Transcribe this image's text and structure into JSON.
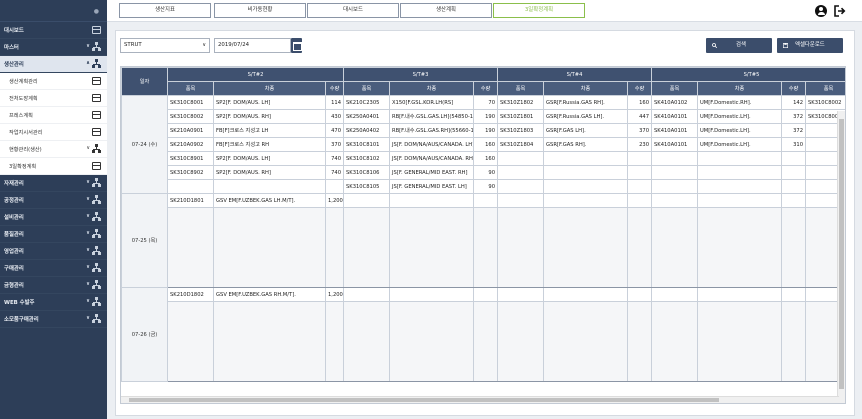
{
  "sidebar": {
    "items": [
      {
        "label": "대시보드",
        "type": "top",
        "icon": "window-icon"
      },
      {
        "label": "마스터",
        "type": "top",
        "icon": "tree-icon",
        "chevron": "∨"
      },
      {
        "label": "생산관리",
        "type": "open",
        "icon": "tree-icon",
        "chevron": "∧"
      },
      {
        "label": "생산계획관리",
        "type": "sub",
        "icon": "window-icon"
      },
      {
        "label": "전처도장계획",
        "type": "sub",
        "icon": "window-icon"
      },
      {
        "label": "프레스계획",
        "type": "sub",
        "icon": "window-icon"
      },
      {
        "label": "작업지시서관리",
        "type": "sub",
        "icon": "window-icon"
      },
      {
        "label": "현황관리(생산)",
        "type": "sub",
        "icon": "tree-icon",
        "chevron": "∨"
      },
      {
        "label": "3일확정계획",
        "type": "sub",
        "icon": "window-icon"
      },
      {
        "label": "자재관리",
        "type": "top",
        "icon": "tree-icon",
        "chevron": "∨"
      },
      {
        "label": "공정관리",
        "type": "top",
        "icon": "tree-icon",
        "chevron": "∨"
      },
      {
        "label": "설비관리",
        "type": "top",
        "icon": "tree-icon",
        "chevron": "∨"
      },
      {
        "label": "품질관리",
        "type": "top",
        "icon": "tree-icon",
        "chevron": "∨"
      },
      {
        "label": "영업관리",
        "type": "top",
        "icon": "tree-icon",
        "chevron": "∨"
      },
      {
        "label": "구매관리",
        "type": "top",
        "icon": "tree-icon",
        "chevron": "∨"
      },
      {
        "label": "금형관리",
        "type": "top",
        "icon": "tree-icon",
        "chevron": "∨"
      },
      {
        "label": "WEB 수발주",
        "type": "top",
        "icon": "tree-icon",
        "chevron": "∨"
      },
      {
        "label": "소모품구매관리",
        "type": "top",
        "icon": "tree-icon",
        "chevron": "∨"
      }
    ]
  },
  "tabs": [
    {
      "label": "생산지표",
      "active": false
    },
    {
      "label": "비가동현황",
      "active": false
    },
    {
      "label": "대시보드",
      "active": false
    },
    {
      "label": "생산계획",
      "active": false
    },
    {
      "label": "3일확정계획",
      "active": true
    }
  ],
  "toolbar": {
    "select_value": "STRUT",
    "select_arrow": "∨",
    "date_value": "2019/07/24",
    "search_label": "검색",
    "excel_label": "엑셀다운로드"
  },
  "grid": {
    "date_header": "일자",
    "groups": [
      "S/T#2",
      "S/T#3",
      "S/T#4",
      "S/T#5"
    ],
    "col_item": "품목",
    "col_car": "차종",
    "col_qty": "수량",
    "days": [
      {
        "label": "07-24 (수)",
        "rows": [
          [
            "SK310C8001",
            "SP2[F. DOM/AUS. LH]",
            "114",
            "SK210C2305",
            "X150[F.GSL.KOR.LH(RS]",
            "70",
            "SK310Z1802",
            "GSR[F.Russia.GAS RH].",
            "160",
            "SK410A0102",
            "UM[F.Domestic.RH].",
            "142",
            "SK310C8002"
          ],
          [
            "SK310C8002",
            "SP2[F. DOM/AUS. RH]",
            "430",
            "SK250A0401",
            "RB[F.내수.GSL.GAS.LH](54850-1R",
            "190",
            "SK310Z1801",
            "GSR[F.Russia.GAS LH].",
            "447",
            "SK410A0101",
            "UM[F.Domestic.LH].",
            "372",
            "SK310C8001"
          ],
          [
            "SK210A0901",
            "FB[F]크로스 지성고 LH",
            "470",
            "SK250A0402",
            "RB[F.내수.GSL.GAS.RH](55660-1R",
            "190",
            "SK310Z1803",
            "GSR[F.GAS LH].",
            "370",
            "SK410A0101",
            "UM[F.Domestic.LH].",
            "372",
            ""
          ],
          [
            "SK210A0902",
            "FB[F]크로스 지성고 RH",
            "370",
            "SK310C8101",
            "JS[F. DOM/NA/AUS/CANADA. LH]",
            "160",
            "SK310Z1804",
            "GSR[F.GAS RH].",
            "230",
            "SK410A0101",
            "UM[F.Domestic.LH].",
            "310",
            ""
          ],
          [
            "SK310C8901",
            "SP2[F. DOM/AUS. LH]",
            "740",
            "SK310C8102",
            "JS[F. DOM/NA/AUS/CANADA. RH]",
            "160",
            "",
            "",
            "",
            "",
            "",
            "",
            ""
          ],
          [
            "SK310C8902",
            "SP2[F. DOM/AUS. RH]",
            "740",
            "SK310C8106",
            "JS[F. GENERAL/MID EAST. RH]",
            "90",
            "",
            "",
            "",
            "",
            "",
            "",
            ""
          ],
          [
            "",
            "",
            "",
            "SK310C8105",
            "JS[F. GENERAL/MID EAST. LH]",
            "90",
            "",
            "",
            "",
            "",
            "",
            "",
            ""
          ]
        ]
      },
      {
        "label": "07-25 (목)",
        "rows": [
          [
            "SK210D1801",
            "GSV EM[F.UZBEK.GAS LH.M/T].",
            "1,200",
            "",
            "",
            "",
            "",
            "",
            "",
            "",
            "",
            "",
            ""
          ]
        ]
      },
      {
        "label": "07-26 (금)",
        "rows": [
          [
            "SK210D1802",
            "GSV EM[F.UZBEK.GAS RH.M/T].",
            "1,200",
            "",
            "",
            "",
            "",
            "",
            "",
            "",
            "",
            "",
            ""
          ]
        ]
      }
    ]
  }
}
